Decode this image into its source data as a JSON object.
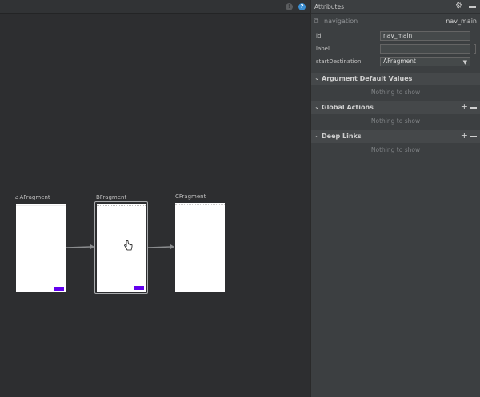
{
  "canvas": {
    "toolbar": {
      "info_icon": "info-icon",
      "help_icon": "help-icon"
    },
    "fragments": [
      {
        "label": "AFragment",
        "is_start": true,
        "icon": "home-icon"
      },
      {
        "label": "BFragment",
        "is_start": false,
        "selected": true
      },
      {
        "label": "CFragment",
        "is_start": false
      }
    ],
    "accent_color": "#6200ee"
  },
  "panel": {
    "title": "Attributes",
    "component": {
      "type": "navigation",
      "id": "nav_main",
      "icon": "navigation-icon"
    },
    "attributes": [
      {
        "label": "id",
        "value": "nav_main"
      },
      {
        "label": "label",
        "value": ""
      },
      {
        "label": "startDestination",
        "value": "AFragment"
      }
    ],
    "sections": [
      {
        "title": "Argument Default Values",
        "empty_text": "Nothing to show",
        "has_actions": false
      },
      {
        "title": "Global Actions",
        "empty_text": "Nothing to show",
        "has_actions": true
      },
      {
        "title": "Deep Links",
        "empty_text": "Nothing to show",
        "has_actions": true
      }
    ]
  }
}
